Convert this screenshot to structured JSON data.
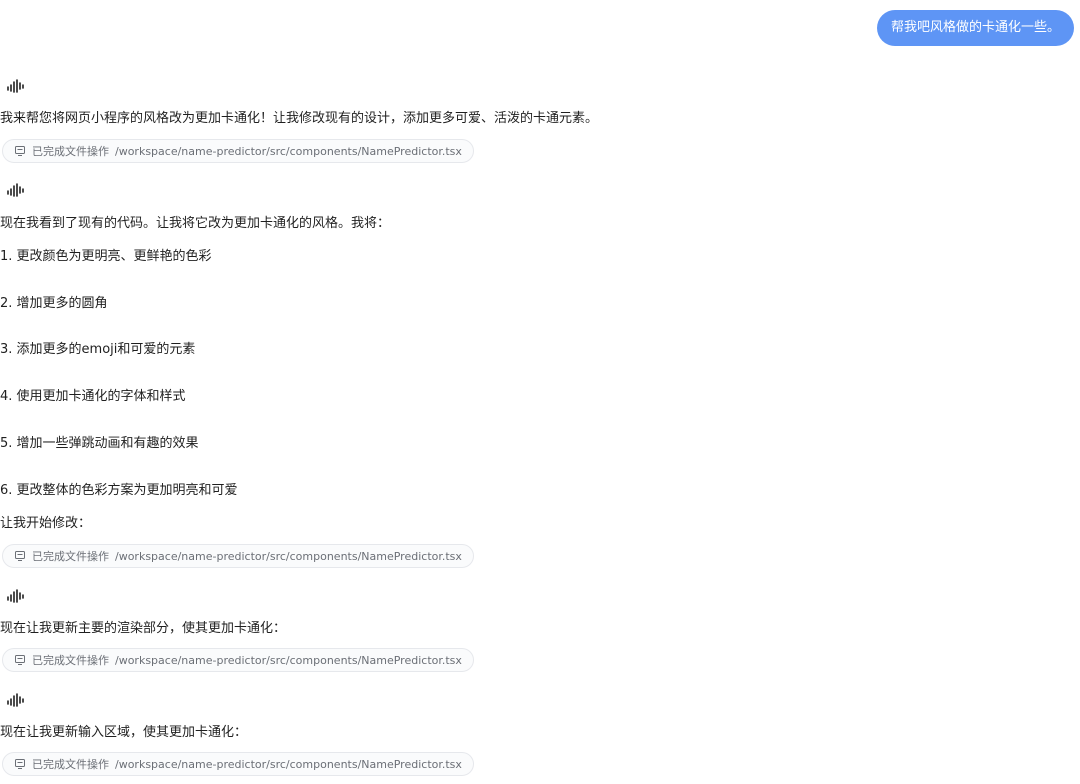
{
  "user_message": "帮我吧风格做的卡通化一些。",
  "assistant": {
    "intro": "我来帮您将网页小程序的风格改为更加卡通化！让我修改现有的设计，添加更多可爱、活泼的卡通元素。",
    "seen_code": "现在我看到了现有的代码。让我将它改为更加卡通化的风格。我将：",
    "steps": [
      "1. 更改颜色为更明亮、更鲜艳的色彩",
      "2. 增加更多的圆角",
      "3. 添加更多的emoji和可爱的元素",
      "4. 使用更加卡通化的字体和样式",
      "5. 增加一些弹跳动画和有趣的效果",
      "6. 更改整体的色彩方案为更加明亮和可爱"
    ],
    "start_modify": "让我开始修改：",
    "update_render": "现在让我更新主要的渲染部分，使其更加卡通化：",
    "update_input": "现在让我更新输入区域，使其更加卡通化："
  },
  "file_op": {
    "status": "已完成文件操作",
    "path": "/workspace/name-predictor/src/components/NamePredictor.tsx",
    "icon": "file-op-icon"
  },
  "assistant_icon": "sound-wave-icon",
  "colors": {
    "user_bubble": "#5e95f5"
  }
}
